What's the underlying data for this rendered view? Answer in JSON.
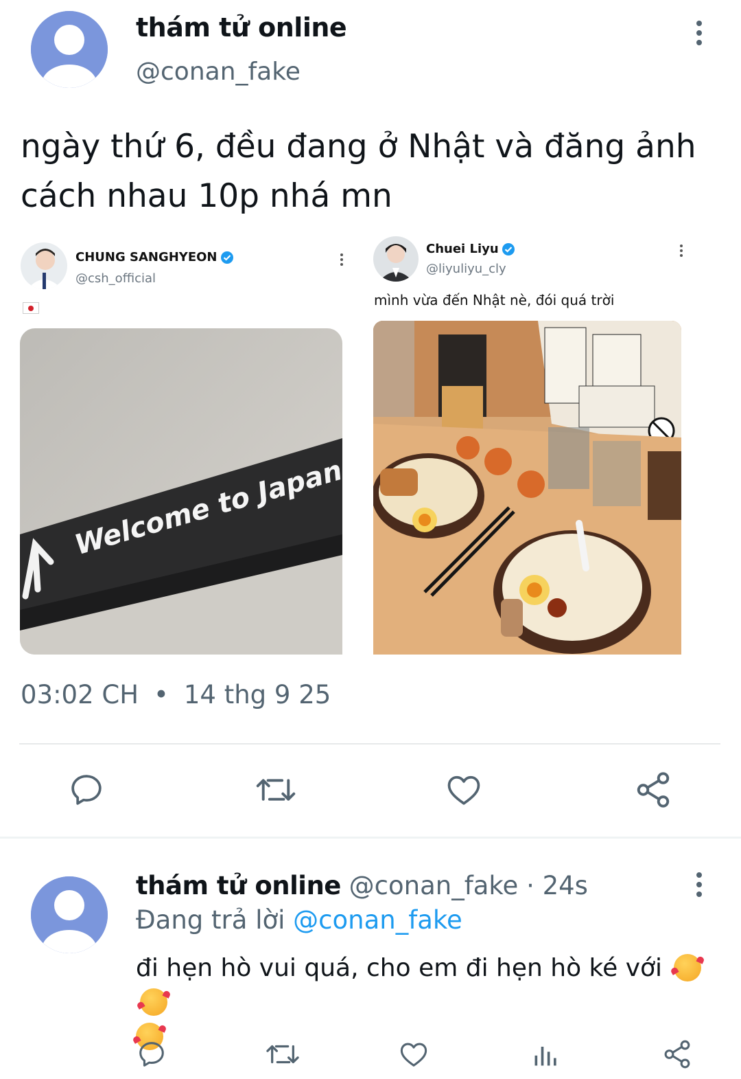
{
  "post": {
    "author_name": "thám tử online",
    "author_handle": "@conan_fake",
    "text": "ngày thứ 6, đều đang ở Nhật và đăng ảnh cách nhau 10p nhá mn",
    "time": "03:02 CH",
    "separator": "•",
    "date": "14 thg 9 25"
  },
  "embeds": {
    "left": {
      "name": "CHUNG SANGHYEON",
      "handle": "@csh_official",
      "flag_icon": "japan-flag-icon",
      "photo_sign_text": "Welcome to Japan"
    },
    "right": {
      "name": "Chuei Liyu",
      "handle": "@liyuliyu_cly",
      "text": "mình vừa đến Nhật nè, đói quá trời",
      "photo_icon": "ramen-photo"
    }
  },
  "actions": [
    "reply-icon",
    "repost-icon",
    "like-icon",
    "share-icon"
  ],
  "reply": {
    "author_name": "thám tử online",
    "author_handle": "@conan_fake",
    "separator": "·",
    "age": "24s",
    "replying_label": "Đang trả lời",
    "replying_to": "@conan_fake",
    "text": "đi hẹn hò vui quá, cho em đi hẹn hò ké với",
    "emoji_icon": "smiling-face-with-hearts-icon",
    "actions": [
      "reply-icon",
      "repost-icon",
      "like-icon",
      "views-icon",
      "share-icon"
    ]
  },
  "colors": {
    "text": "#0f1419",
    "muted": "#536471",
    "link": "#1d9bf0",
    "verified": "#1d9bf0"
  }
}
